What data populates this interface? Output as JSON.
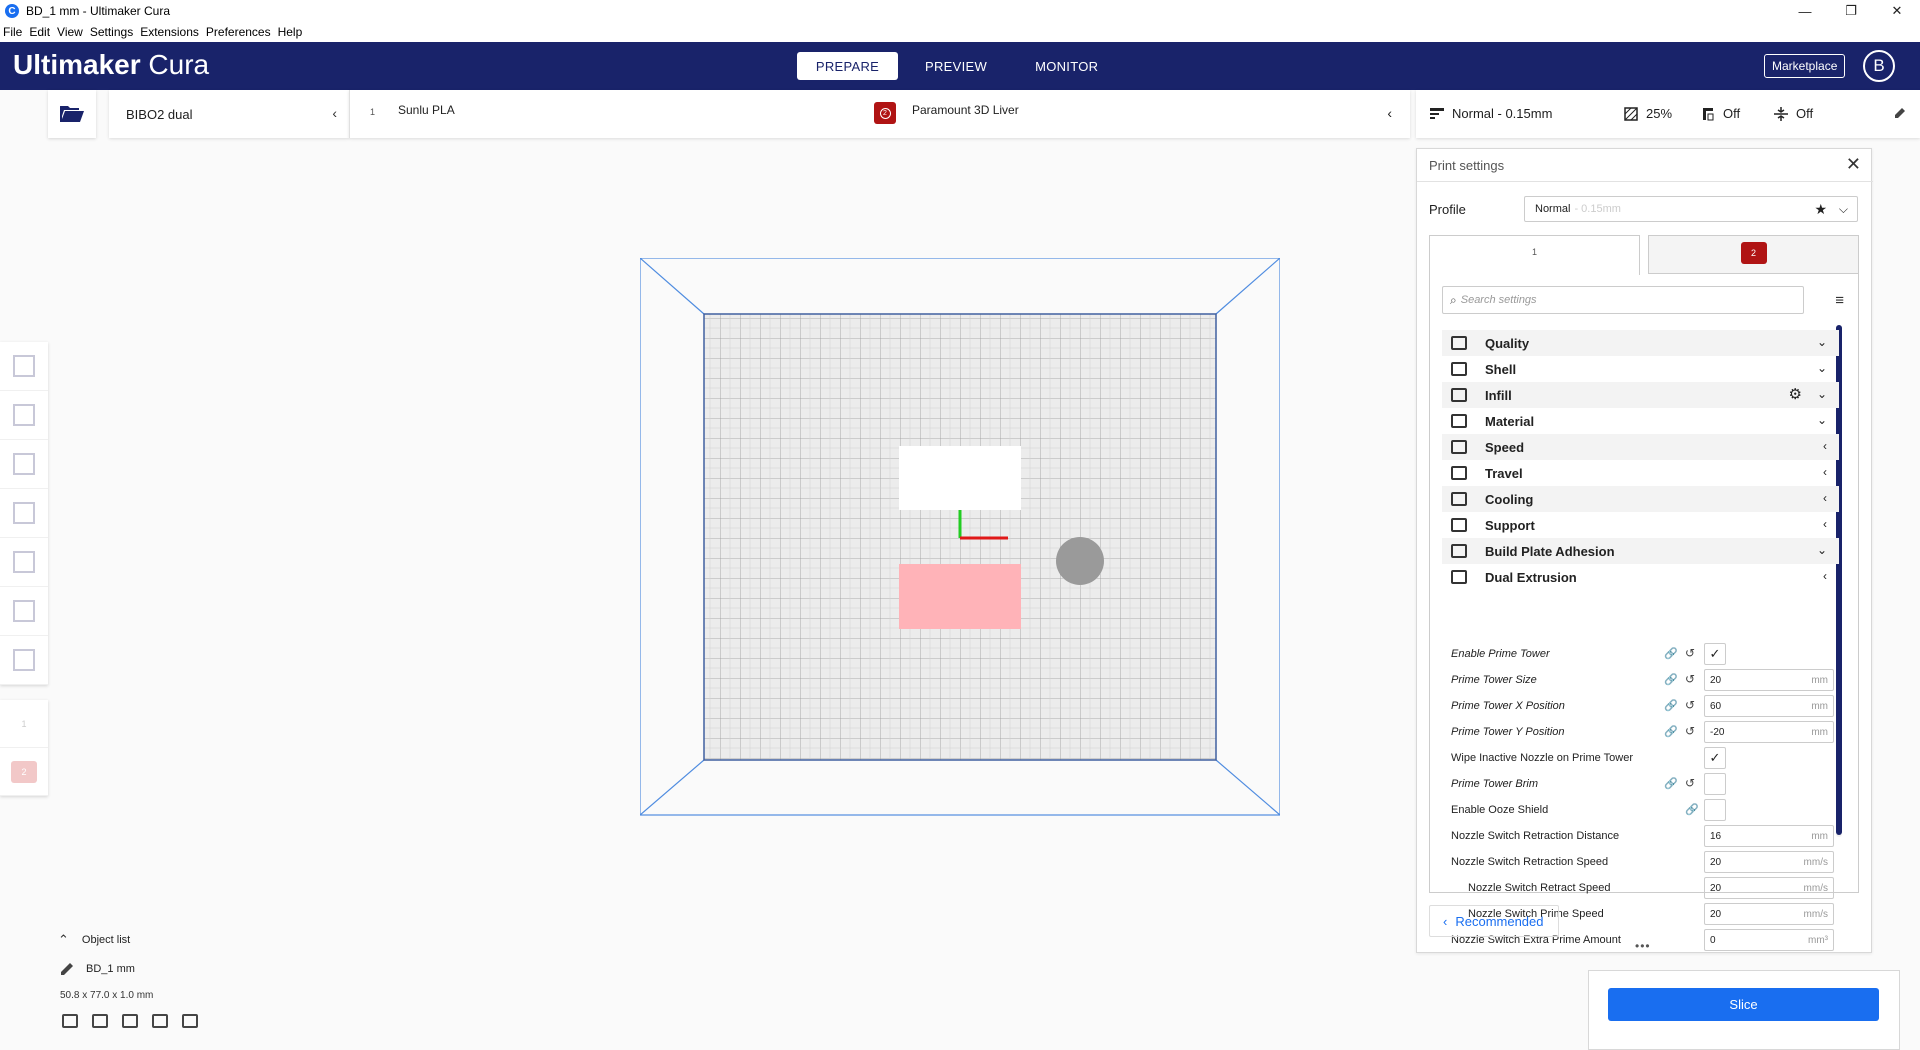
{
  "window": {
    "title": "BD_1 mm - Ultimaker Cura",
    "app_icon": "C",
    "controls": [
      "—",
      "❐",
      "✕"
    ]
  },
  "menu": [
    "File",
    "Edit",
    "View",
    "Settings",
    "Extensions",
    "Preferences",
    "Help"
  ],
  "header": {
    "logo_bold": "Ultimaker",
    "logo_light": "Cura",
    "tabs": [
      "PREPARE",
      "PREVIEW",
      "MONITOR"
    ],
    "active_tab": "PREPARE",
    "marketplace": "Marketplace",
    "avatar": "B"
  },
  "printer": {
    "name": "BIBO2 dual",
    "chevron": "‹"
  },
  "extruders": {
    "e1_num": "1",
    "e1_material": "Sunlu PLA",
    "e2_num": "2",
    "e2_material": "Paramount 3D Liver",
    "chevron": "‹"
  },
  "quick": {
    "profile": "Normal - 0.15mm",
    "infill": "25%",
    "support": "Off",
    "adhesion": "Off"
  },
  "panel": {
    "title": "Print settings",
    "close": "✕",
    "profile_label": "Profile",
    "profile_value": "Normal",
    "profile_suffix": "- 0.15mm",
    "star": "★",
    "chevron": "⌵",
    "tab1": "1",
    "tab2": "2",
    "search_placeholder": "Search settings",
    "menu_icon": "≡",
    "categories": [
      {
        "label": "Quality",
        "chev": "⌄"
      },
      {
        "label": "Shell",
        "chev": "⌄"
      },
      {
        "label": "Infill",
        "chev": "⌄",
        "gear": "⚙"
      },
      {
        "label": "Material",
        "chev": "⌄"
      },
      {
        "label": "Speed",
        "chev": "‹"
      },
      {
        "label": "Travel",
        "chev": "‹"
      },
      {
        "label": "Cooling",
        "chev": "‹"
      },
      {
        "label": "Support",
        "chev": "‹"
      },
      {
        "label": "Build Plate Adhesion",
        "chev": "⌄"
      },
      {
        "label": "Dual Extrusion",
        "chev": "‹"
      }
    ],
    "settings": [
      {
        "label": "Enable Prime Tower",
        "check": "✓"
      },
      {
        "label": "Prime Tower Size",
        "value": "20",
        "unit": "mm"
      },
      {
        "label": "Prime Tower X Position",
        "value": "60",
        "unit": "mm"
      },
      {
        "label": "Prime Tower Y Position",
        "value": "-20",
        "unit": "mm"
      },
      {
        "label": "Wipe Inactive Nozzle on Prime Tower",
        "check": "✓"
      },
      {
        "label": "Prime Tower Brim",
        "check": ""
      },
      {
        "label": "Enable Ooze Shield",
        "check": ""
      },
      {
        "label": "Nozzle Switch Retraction Distance",
        "value": "16",
        "unit": "mm"
      },
      {
        "label": "Nozzle Switch Retraction Speed",
        "value": "20",
        "unit": "mm/s"
      },
      {
        "label": "Nozzle Switch Retract Speed",
        "value": "20",
        "unit": "mm/s"
      },
      {
        "label": "Nozzle Switch Prime Speed",
        "value": "20",
        "unit": "mm/s"
      },
      {
        "label": "Nozzle Switch Extra Prime Amount",
        "value": "0",
        "unit": "mm³"
      }
    ],
    "recommended": "Recommended",
    "recommended_chev": "‹",
    "drag_handle": "•••"
  },
  "objects": {
    "caret": "⌃",
    "title": "Object list",
    "name": "BD_1 mm",
    "dims": "50.8 x 77.0 x 1.0 mm"
  },
  "slice": {
    "label": "Slice"
  },
  "colors": {
    "header": "#19236a",
    "accent": "#196ef0",
    "extruder2": "#b01414",
    "object_pink": "#ffb3b8"
  }
}
